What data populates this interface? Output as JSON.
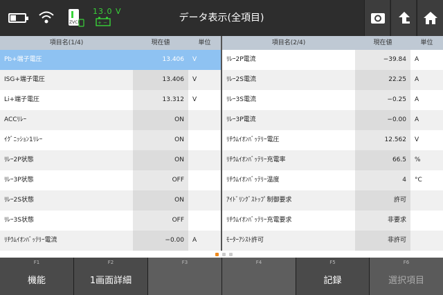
{
  "header": {
    "title": "データ表示(全項目)",
    "voltage": "13.0 V",
    "vci_label": "ZVCI"
  },
  "left_table": {
    "columns": [
      "項目名(1/4)",
      "現在値",
      "単位"
    ],
    "rows": [
      {
        "name": "Pb+端子電圧",
        "value": "13.406",
        "unit": "V",
        "selected": true
      },
      {
        "name": "ISG+端子電圧",
        "value": "13.406",
        "unit": "V"
      },
      {
        "name": "Li+端子電圧",
        "value": "13.312",
        "unit": "V"
      },
      {
        "name": "ACCﾘﾚｰ",
        "value": "ON",
        "unit": ""
      },
      {
        "name": "ｲｸﾞﾆｯｼｮﾝ1ﾘﾚｰ",
        "value": "ON",
        "unit": ""
      },
      {
        "name": "ﾘﾚｰ2P状態",
        "value": "ON",
        "unit": ""
      },
      {
        "name": "ﾘﾚｰ3P状態",
        "value": "OFF",
        "unit": ""
      },
      {
        "name": "ﾘﾚｰ2S状態",
        "value": "ON",
        "unit": ""
      },
      {
        "name": "ﾘﾚｰ3S状態",
        "value": "OFF",
        "unit": ""
      },
      {
        "name": "ﾘﾁｳﾑｲｵﾝﾊﾞｯﾃﾘｰ電流",
        "value": "−0.00",
        "unit": "A"
      }
    ]
  },
  "right_table": {
    "columns": [
      "項目名(2/4)",
      "現在値",
      "単位"
    ],
    "rows": [
      {
        "name": "ﾘﾚｰ2P電流",
        "value": "−39.84",
        "unit": "A"
      },
      {
        "name": "ﾘﾚｰ2S電流",
        "value": "22.25",
        "unit": "A"
      },
      {
        "name": "ﾘﾚｰ3S電流",
        "value": "−0.25",
        "unit": "A"
      },
      {
        "name": "ﾘﾚｰ3P電流",
        "value": "−0.00",
        "unit": "A"
      },
      {
        "name": "ﾘﾁｳﾑｲｵﾝﾊﾞｯﾃﾘｰ電圧",
        "value": "12.562",
        "unit": "V"
      },
      {
        "name": "ﾘﾁｳﾑｲｵﾝﾊﾞｯﾃﾘｰ充電率",
        "value": "66.5",
        "unit": "%"
      },
      {
        "name": "ﾘﾁｳﾑｲｵﾝﾊﾞｯﾃﾘｰ温度",
        "value": "4",
        "unit": "°C"
      },
      {
        "name": "ｱｲﾄﾞﾘﾝｸﾞｽﾄｯﾌﾟ制御要求",
        "value": "許可",
        "unit": ""
      },
      {
        "name": "ﾘﾁｳﾑｲｵﾝﾊﾞｯﾃﾘｰ充電要求",
        "value": "非要求",
        "unit": ""
      },
      {
        "name": "ﾓｰﾀｰｱｼｽﾄ許可",
        "value": "非許可",
        "unit": ""
      }
    ]
  },
  "pager": {
    "pages": 3,
    "active": 0
  },
  "function_keys": [
    {
      "key": "F1",
      "label": "機能"
    },
    {
      "key": "F2",
      "label": "1画面詳細"
    },
    {
      "key": "F3",
      "label": ""
    },
    {
      "key": "F4",
      "label": ""
    },
    {
      "key": "F5",
      "label": "記録"
    },
    {
      "key": "F6",
      "label": "選択項目"
    }
  ],
  "colors": {
    "accent_selected": "#8ec2f2",
    "voltage_green": "#39d339",
    "pager_active": "#f08a1c"
  }
}
